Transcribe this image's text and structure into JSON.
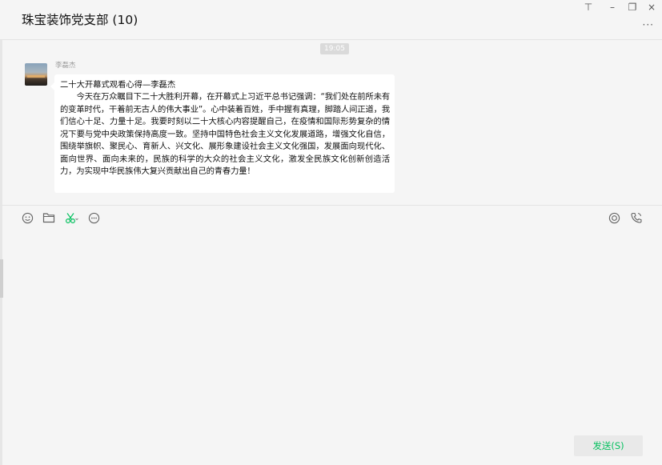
{
  "window": {
    "title": "珠宝装饰党支部 (10)",
    "pin_glyph": "⊤",
    "minimize_glyph": "–",
    "restore_glyph": "❐",
    "close_glyph": "×",
    "more_glyph": "···"
  },
  "messages": {
    "time": "19:05",
    "items": [
      {
        "sender": "李磊杰",
        "title": "二十大开幕式观看心得—李磊杰",
        "body": "今天在万众瞩目下二十大胜利开幕，在开幕式上习近平总书记强调：“我们处在前所未有的变革时代，干着前无古人的伟大事业”。心中装着百姓，手中握有真理，脚踏人间正道，我们信心十足、力量十足。我要时刻以二十大核心内容提醒自己，在疫情和国际形势复杂的情况下要与党中央政策保持高度一致。坚持中国特色社会主义文化发展道路，增强文化自信，围绕举旗帜、聚民心、育新人、兴文化、展形象建设社会主义文化强国，发展面向现代化、面向世界、面向未来的，民族的科学的大众的社会主义文化，激发全民族文化创新创造活力，为实现中华民族伟大复兴贡献出自己的青春力量！"
      }
    ]
  },
  "toolbar": {
    "left_icons": [
      "emoji-icon",
      "folder-icon",
      "scissors-icon",
      "chat-bubble-icon"
    ],
    "right_icons": [
      "live-icon",
      "phone-icon"
    ]
  },
  "composer": {
    "value": "",
    "send_label": "发送(S)"
  },
  "colors": {
    "accent": "#07c160",
    "background": "#f5f5f5",
    "bubble": "#ffffff"
  }
}
